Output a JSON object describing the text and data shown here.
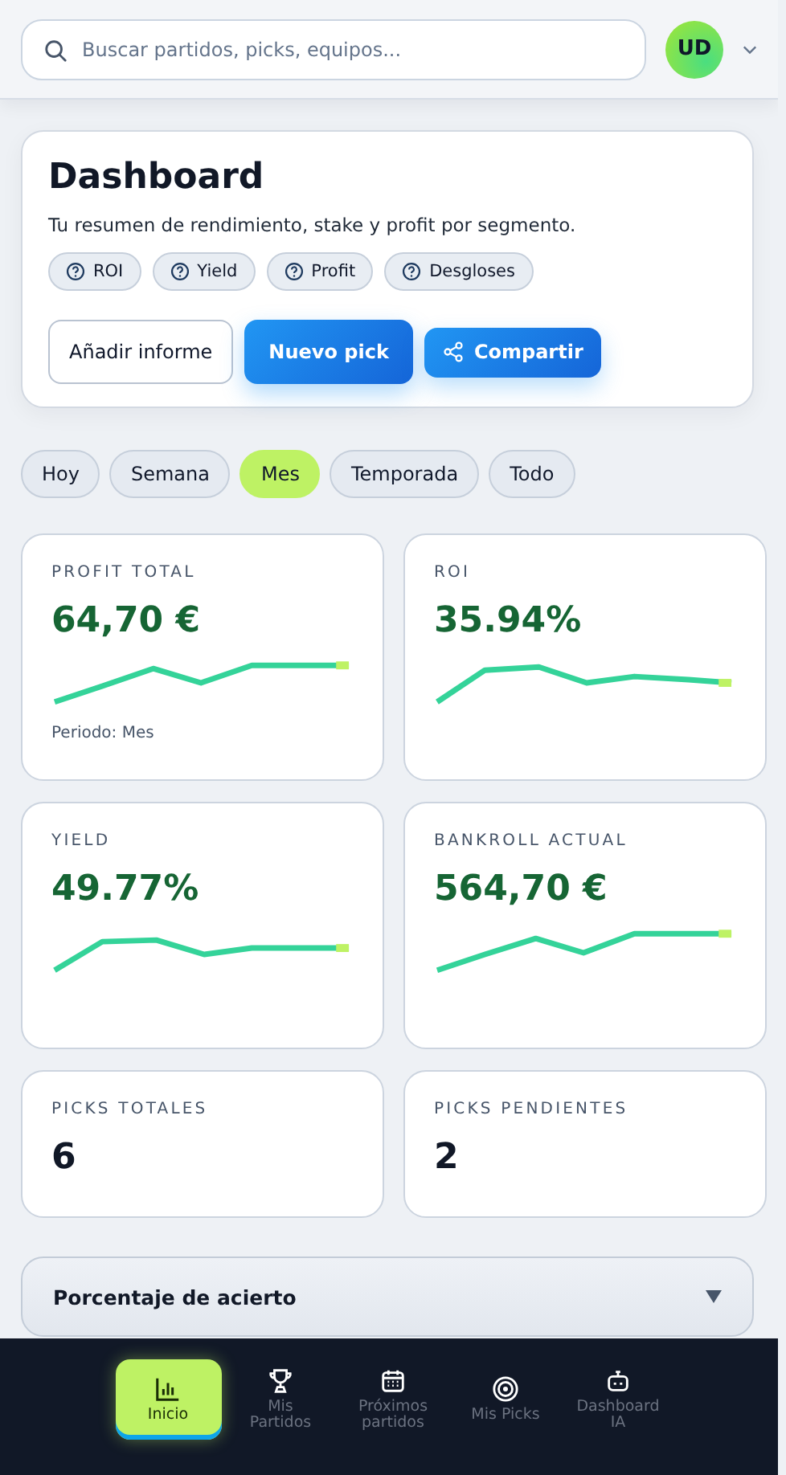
{
  "search": {
    "placeholder": "Buscar partidos, picks, equipos..."
  },
  "user": {
    "initials": "UD"
  },
  "hero": {
    "title": "Dashboard",
    "subtitle": "Tu resumen de rendimiento, stake y profit por segmento.",
    "help_chips": [
      "ROI",
      "Yield",
      "Profit",
      "Desgloses"
    ],
    "buttons": [
      {
        "label": "Añadir informe",
        "kind": "outline"
      },
      {
        "label": "Nuevo pick",
        "kind": "primary"
      },
      {
        "label": "Compartir",
        "kind": "share"
      }
    ]
  },
  "periods": [
    {
      "label": "Hoy",
      "selected": false
    },
    {
      "label": "Semana",
      "selected": false
    },
    {
      "label": "Mes",
      "selected": true
    },
    {
      "label": "Temporada",
      "selected": false
    },
    {
      "label": "Todo",
      "selected": false
    }
  ],
  "stats": [
    {
      "label": "PROFIT TOTAL",
      "value": "64,70 €",
      "kind": "trend",
      "note": "Periodo: Mes"
    },
    {
      "label": "ROI",
      "value": "35.94%",
      "kind": "trend"
    },
    {
      "label": "YIELD",
      "value": "49.77%",
      "kind": "trend"
    },
    {
      "label": "BANKROLL ACTUAL",
      "value": "564,70 €",
      "kind": "trend"
    },
    {
      "label": "PICKS TOTALES",
      "value": "6",
      "kind": "count"
    },
    {
      "label": "PICKS PENDIENTES",
      "value": "2",
      "kind": "count"
    }
  ],
  "accordion": {
    "title": "Porcentaje de acierto",
    "expanded": false
  },
  "nav": [
    {
      "label": "Inicio",
      "selected": true
    },
    {
      "label": "Mis Partidos",
      "selected": false
    },
    {
      "label": "Próximos partidos",
      "selected": false
    },
    {
      "label": "Mis Picks",
      "selected": false
    },
    {
      "label": "Dashboard IA",
      "selected": false
    }
  ]
}
